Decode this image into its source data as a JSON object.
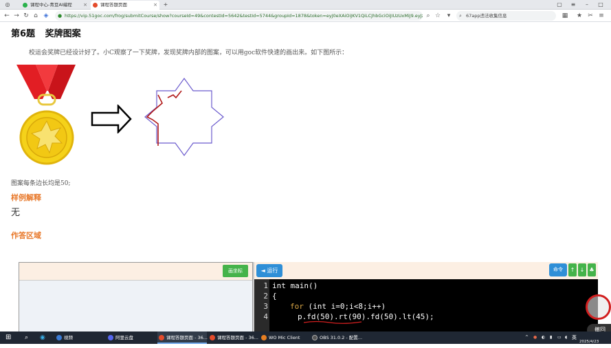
{
  "browser": {
    "tabs": [
      {
        "title": "课程中心-青豆AI编程",
        "active": false
      },
      {
        "title": "课程答题页面",
        "active": true
      }
    ],
    "new_tab": "+",
    "url": "https://vip.51goc.com/frog/submitCourse/show?courseId=49&contestId=5642&testId=5744&groupId=1878&token=eyJ0eXAiOiJKV1QiLCJhbGciOiJIUzUxMiJ9.eyJzdWIi",
    "search_text": "67app违法收集信息"
  },
  "problem": {
    "title": "第6题 奖牌图案",
    "description": "校运会奖牌已经设计好了。小C观察了一下奖牌，发现奖牌内部的图案，可以用goc软件快速的画出来。如下图所示：",
    "side_note": "图案每条边长均是50;"
  },
  "sections": {
    "sample_heading": "样例解释",
    "sample_text": "无",
    "answer_heading": "作答区域"
  },
  "workspace": {
    "coord_button": "画坐标",
    "run_button": "◄ 运行",
    "command_button": "命令",
    "up_arrow": "↑",
    "down_arrow": "↓",
    "home_button": "♣",
    "undo_button": "撤回",
    "code_lines": [
      {
        "num": "1",
        "text": "int main()"
      },
      {
        "num": "2",
        "text": "{"
      },
      {
        "num": "3",
        "kw": "for",
        "rest": " (int i=0;i<8;i++)"
      },
      {
        "num": "4",
        "text": "p.fd(50).rt(90).fd(50).lt(45);"
      }
    ]
  },
  "taskbar": {
    "items": [
      {
        "label": "视频",
        "color": "#3b7bd4"
      },
      {
        "label": "阿里云盘",
        "color": "#5566ee"
      },
      {
        "label": "课程答题页面 - 36...",
        "color": "#e44c2c"
      },
      {
        "label": "课程答题页面 - 36...",
        "color": "#e44c2c"
      },
      {
        "label": "WO Mic Client",
        "color": "#e67e22"
      },
      {
        "label": "OBS 31.0.2 - 配置...",
        "color": "#222222"
      }
    ],
    "lang": "英",
    "date": "2025/4/23"
  },
  "colors": {
    "accent_orange": "#e8792b",
    "run_blue": "#2f8fd7",
    "button_green": "#45b34a",
    "star_purple": "#6a5acd",
    "pen_red": "#b01818"
  }
}
